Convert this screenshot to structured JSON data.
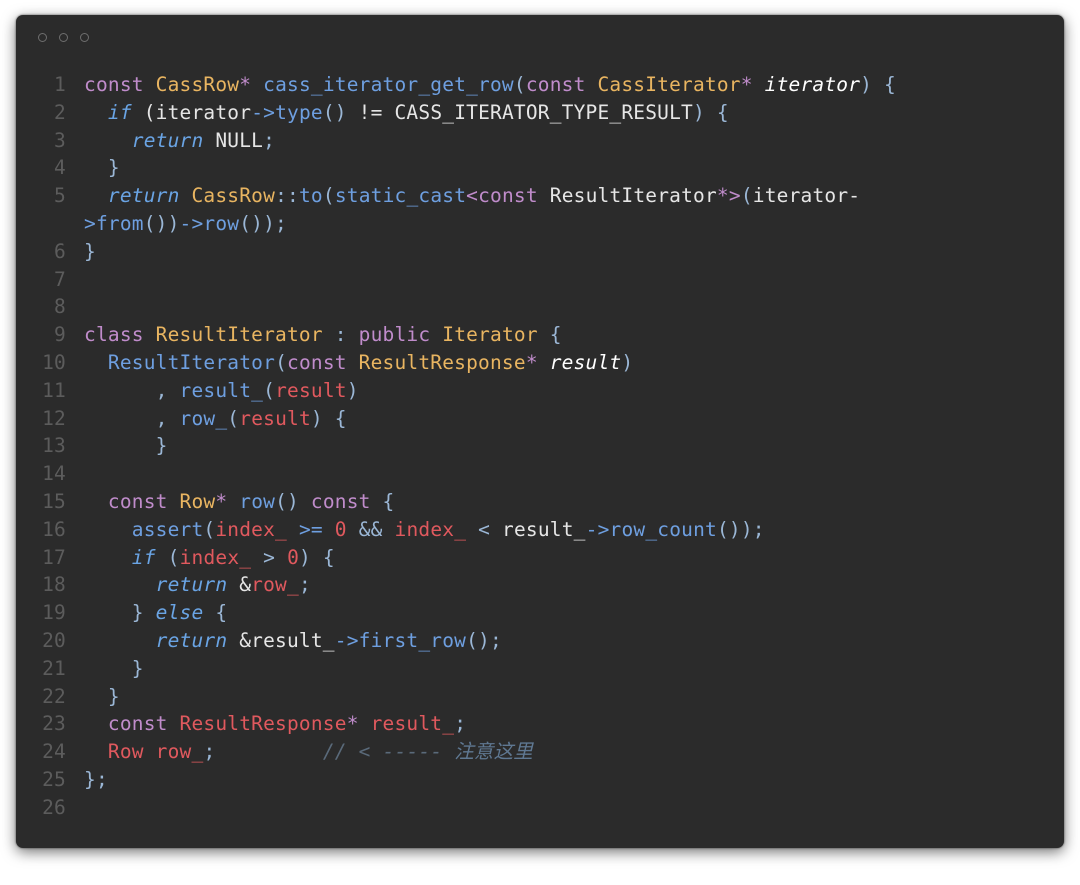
{
  "window": {
    "controls": [
      "close",
      "minimize",
      "zoom"
    ]
  },
  "colors": {
    "background": "#2b2b2b",
    "keyword": "#c08ccb",
    "type": "#e9b561",
    "function": "#6e9fe0",
    "variable": "#e0595e",
    "comment": "#5f7892",
    "line_number": "#5c5c5c"
  },
  "code": {
    "lines": [
      {
        "n": "1",
        "t": [
          [
            "kw",
            "const "
          ],
          [
            "ty",
            "CassRow"
          ],
          [
            "kw",
            "* "
          ],
          [
            "fn",
            "cass_iterator_get_row"
          ],
          [
            "p",
            "("
          ],
          [
            "kw",
            "const "
          ],
          [
            "ty",
            "CassIterator"
          ],
          [
            "kw",
            "* "
          ],
          [
            "it",
            "iterator"
          ],
          [
            "p",
            ") {"
          ]
        ]
      },
      {
        "n": "2",
        "t": [
          [
            "id",
            "  "
          ],
          [
            "ctl",
            "if"
          ],
          [
            "id",
            " (iterator"
          ],
          [
            "fn",
            "->"
          ],
          [
            "fn",
            "type"
          ],
          [
            "p",
            "()"
          ],
          [
            "id",
            " != CASS_ITERATOR_TYPE_RESULT"
          ],
          [
            "p",
            ") {"
          ]
        ]
      },
      {
        "n": "3",
        "t": [
          [
            "id",
            "    "
          ],
          [
            "ctl",
            "return"
          ],
          [
            "id",
            " NULL"
          ],
          [
            "p",
            ";"
          ]
        ]
      },
      {
        "n": "4",
        "t": [
          [
            "p",
            "  }"
          ]
        ]
      },
      {
        "n": "5",
        "t": [
          [
            "id",
            "  "
          ],
          [
            "ctl",
            "return"
          ],
          [
            "id",
            " "
          ],
          [
            "ty",
            "CassRow"
          ],
          [
            "p",
            "::"
          ],
          [
            "fn",
            "to"
          ],
          [
            "p",
            "("
          ],
          [
            "fn",
            "static_cast"
          ],
          [
            "kw",
            "<const "
          ],
          [
            "id",
            "ResultIterator"
          ],
          [
            "kw",
            "*>"
          ],
          [
            "p",
            "("
          ],
          [
            "id",
            "iterator-"
          ]
        ]
      },
      {
        "n": "",
        "t": [
          [
            "fn",
            ">from"
          ],
          [
            "p",
            "())"
          ],
          [
            "fn",
            "->row"
          ],
          [
            "p",
            "());"
          ]
        ]
      },
      {
        "n": "6",
        "t": [
          [
            "p",
            "}"
          ]
        ]
      },
      {
        "n": "7",
        "t": []
      },
      {
        "n": "8",
        "t": []
      },
      {
        "n": "9",
        "t": [
          [
            "kw",
            "class "
          ],
          [
            "ty",
            "ResultIterator"
          ],
          [
            "id",
            " "
          ],
          [
            "p",
            ": "
          ],
          [
            "kw",
            "public "
          ],
          [
            "ty",
            "Iterator"
          ],
          [
            "p",
            " {"
          ]
        ]
      },
      {
        "n": "10",
        "t": [
          [
            "id",
            "  "
          ],
          [
            "fn",
            "ResultIterator"
          ],
          [
            "p",
            "("
          ],
          [
            "kw",
            "const "
          ],
          [
            "ty",
            "ResultResponse"
          ],
          [
            "kw",
            "* "
          ],
          [
            "it",
            "result"
          ],
          [
            "p",
            ")"
          ]
        ]
      },
      {
        "n": "11",
        "t": [
          [
            "id",
            "      "
          ],
          [
            "p",
            ", "
          ],
          [
            "fn",
            "result_"
          ],
          [
            "p",
            "("
          ],
          [
            "var",
            "result"
          ],
          [
            "p",
            ")"
          ]
        ]
      },
      {
        "n": "12",
        "t": [
          [
            "id",
            "      "
          ],
          [
            "p",
            ", "
          ],
          [
            "fn",
            "row_"
          ],
          [
            "p",
            "("
          ],
          [
            "var",
            "result"
          ],
          [
            "p",
            ") {"
          ]
        ]
      },
      {
        "n": "13",
        "t": [
          [
            "p",
            "      }"
          ]
        ]
      },
      {
        "n": "14",
        "t": []
      },
      {
        "n": "15",
        "t": [
          [
            "id",
            "  "
          ],
          [
            "kw",
            "const "
          ],
          [
            "ty",
            "Row"
          ],
          [
            "kw",
            "* "
          ],
          [
            "fn",
            "row"
          ],
          [
            "p",
            "() "
          ],
          [
            "kw",
            "const"
          ],
          [
            "p",
            " {"
          ]
        ]
      },
      {
        "n": "16",
        "t": [
          [
            "id",
            "    "
          ],
          [
            "fn",
            "assert"
          ],
          [
            "p",
            "("
          ],
          [
            "var",
            "index_"
          ],
          [
            "id",
            " "
          ],
          [
            "fn",
            ">="
          ],
          [
            "id",
            " "
          ],
          [
            "num",
            "0"
          ],
          [
            "id",
            " "
          ],
          [
            "p",
            "&&"
          ],
          [
            "id",
            " "
          ],
          [
            "var",
            "index_"
          ],
          [
            "id",
            " "
          ],
          [
            "p",
            "<"
          ],
          [
            "id",
            " result_"
          ],
          [
            "fn",
            "->row_count"
          ],
          [
            "p",
            "());"
          ]
        ]
      },
      {
        "n": "17",
        "t": [
          [
            "id",
            "    "
          ],
          [
            "ctl",
            "if"
          ],
          [
            "id",
            " "
          ],
          [
            "p",
            "("
          ],
          [
            "var",
            "index_"
          ],
          [
            "id",
            " "
          ],
          [
            "p",
            ">"
          ],
          [
            "id",
            " "
          ],
          [
            "num",
            "0"
          ],
          [
            "p",
            ") {"
          ]
        ]
      },
      {
        "n": "18",
        "t": [
          [
            "id",
            "      "
          ],
          [
            "ctl",
            "return"
          ],
          [
            "id",
            " &"
          ],
          [
            "var",
            "row_"
          ],
          [
            "p",
            ";"
          ]
        ]
      },
      {
        "n": "19",
        "t": [
          [
            "p",
            "    } "
          ],
          [
            "ctl",
            "else"
          ],
          [
            "p",
            " {"
          ]
        ]
      },
      {
        "n": "20",
        "t": [
          [
            "id",
            "      "
          ],
          [
            "ctl",
            "return"
          ],
          [
            "id",
            " &result_"
          ],
          [
            "fn",
            "->first_row"
          ],
          [
            "p",
            "();"
          ]
        ]
      },
      {
        "n": "21",
        "t": [
          [
            "p",
            "    }"
          ]
        ]
      },
      {
        "n": "22",
        "t": [
          [
            "p",
            "  }"
          ]
        ]
      },
      {
        "n": "23",
        "t": [
          [
            "id",
            "  "
          ],
          [
            "kw",
            "const "
          ],
          [
            "var",
            "ResultResponse"
          ],
          [
            "kw",
            "* "
          ],
          [
            "var",
            "result_"
          ],
          [
            "p",
            ";"
          ]
        ]
      },
      {
        "n": "24",
        "t": [
          [
            "id",
            "  "
          ],
          [
            "var",
            "Row"
          ],
          [
            "id",
            " "
          ],
          [
            "var",
            "row_"
          ],
          [
            "p",
            ";"
          ],
          [
            "id",
            "         "
          ],
          [
            "cm",
            "// < ----- "
          ],
          [
            "cm2",
            "注意这里"
          ]
        ]
      },
      {
        "n": "25",
        "t": [
          [
            "p",
            "};"
          ]
        ]
      },
      {
        "n": "26",
        "t": []
      }
    ]
  }
}
